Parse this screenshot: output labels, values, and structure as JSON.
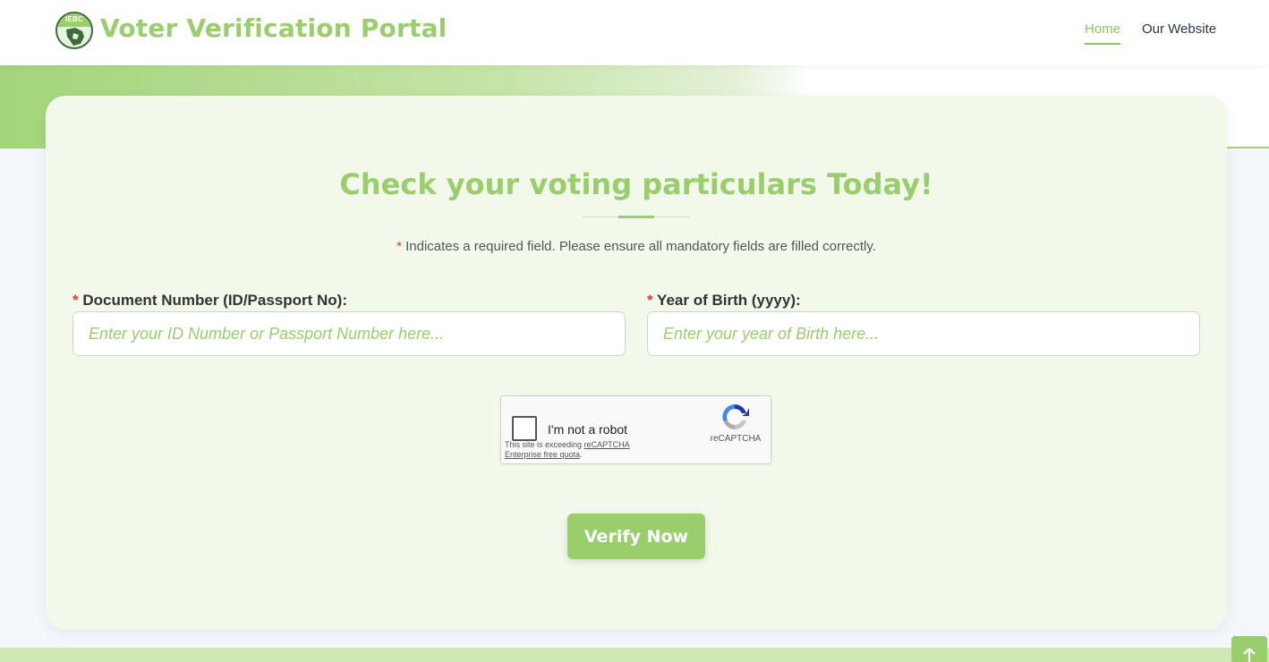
{
  "header": {
    "logo_text": "IEBC",
    "brand": "Voter Verification Portal",
    "nav": [
      {
        "label": "Home",
        "active": true
      },
      {
        "label": "Our Website",
        "active": false
      }
    ]
  },
  "form": {
    "title": "Check your voting particulars Today!",
    "required_marker": "*",
    "note": "Indicates a required field. Please ensure all mandatory fields are filled correctly.",
    "document_field": {
      "label": "Document Number (ID/Passport No):",
      "value": "",
      "placeholder": "Enter your ID Number or Passport Number here..."
    },
    "birth_year_field": {
      "label": "Year of Birth (yyyy):",
      "value": "",
      "placeholder": "Enter your year of Birth here..."
    },
    "captcha": {
      "label": "I'm not a robot",
      "warning_prefix": "This site is exceeding",
      "warning_link": "reCAPTCHA Enterprise free quota",
      "warning_suffix": ".",
      "brand": "reCAPTCHA",
      "checked": false
    },
    "submit_label": "Verify Now"
  },
  "scroll_top_icon": "arrow-up-icon",
  "colors": {
    "accent": "#9acd6b",
    "required": "#e53935",
    "card_bg": "#f2f8ea"
  }
}
